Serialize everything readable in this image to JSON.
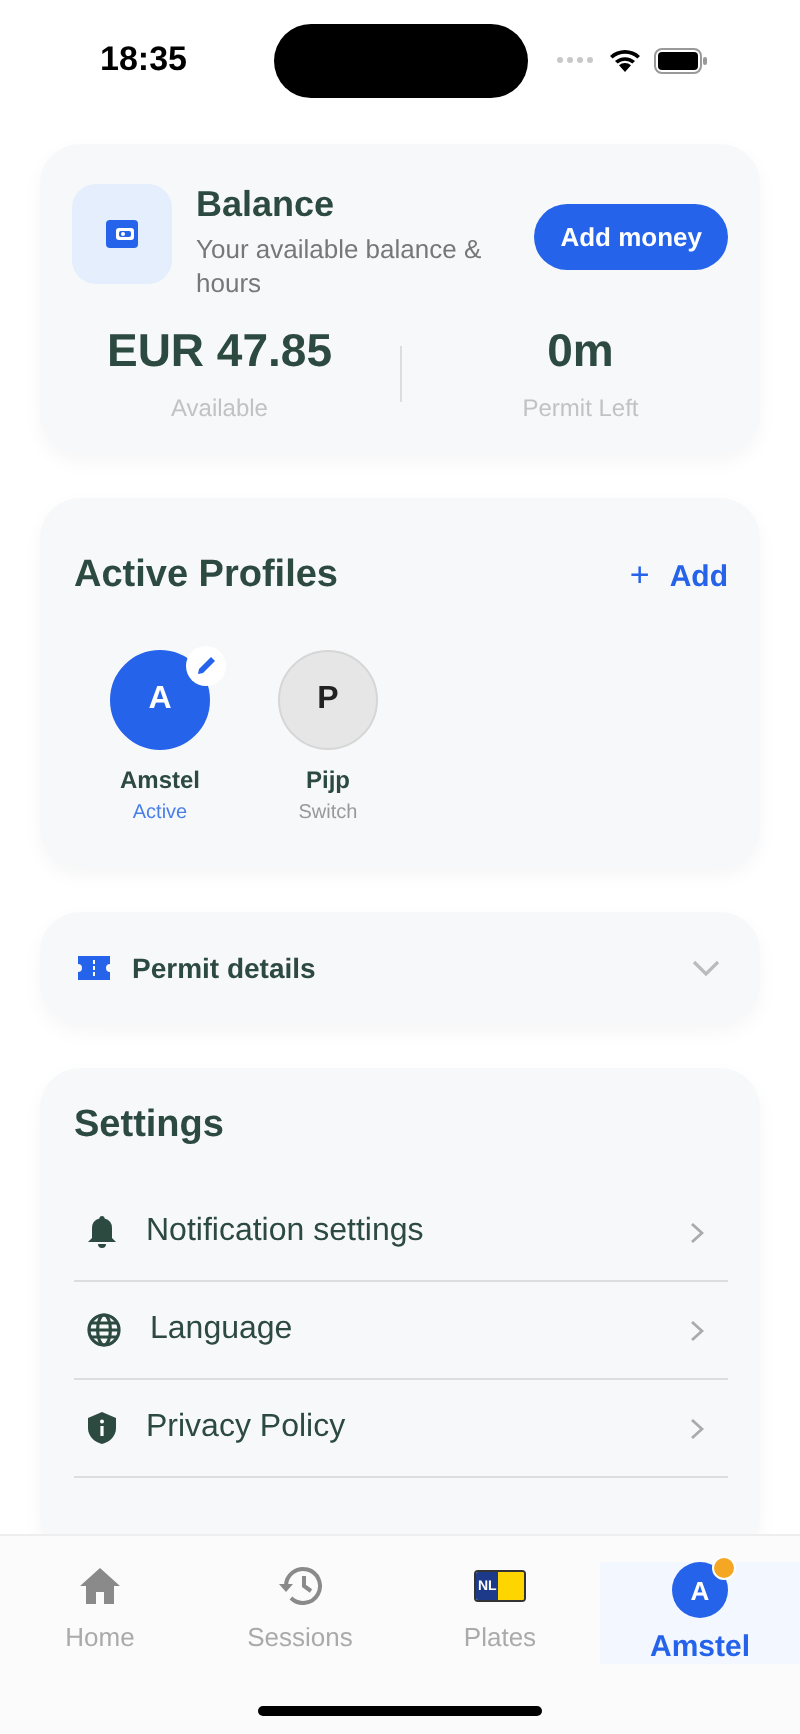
{
  "status_bar": {
    "time": "18:35"
  },
  "balance": {
    "title": "Balance",
    "subtitle": "Your available balance & hours",
    "button": "Add money",
    "stats": [
      {
        "value": "EUR 47.85",
        "label": "Available"
      },
      {
        "value": "0m",
        "label": "Permit Left"
      }
    ]
  },
  "profiles": {
    "title": "Active Profiles",
    "add_label": "Add",
    "add_icon": "+",
    "items": [
      {
        "initial": "A",
        "name": "Amstel",
        "status": "Active",
        "selected": true
      },
      {
        "initial": "P",
        "name": "Pijp",
        "status": "Switch",
        "selected": false
      }
    ]
  },
  "permit": {
    "title": "Permit details",
    "expanded": false
  },
  "settings": {
    "title": "Settings",
    "items": [
      {
        "kind": "bell",
        "label": "Notification settings"
      },
      {
        "kind": "globe",
        "label": "Language"
      },
      {
        "kind": "shield",
        "label": "Privacy Policy"
      }
    ]
  },
  "tabs": [
    {
      "kind": "home",
      "label": "Home",
      "selected": false
    },
    {
      "kind": "sessions",
      "label": "Sessions",
      "selected": false
    },
    {
      "kind": "plates",
      "label": "Plates",
      "plate_text": "NL",
      "selected": false
    },
    {
      "kind": "avatar",
      "label": "Amstel",
      "initial": "A",
      "notification": true,
      "selected": true
    }
  ]
}
